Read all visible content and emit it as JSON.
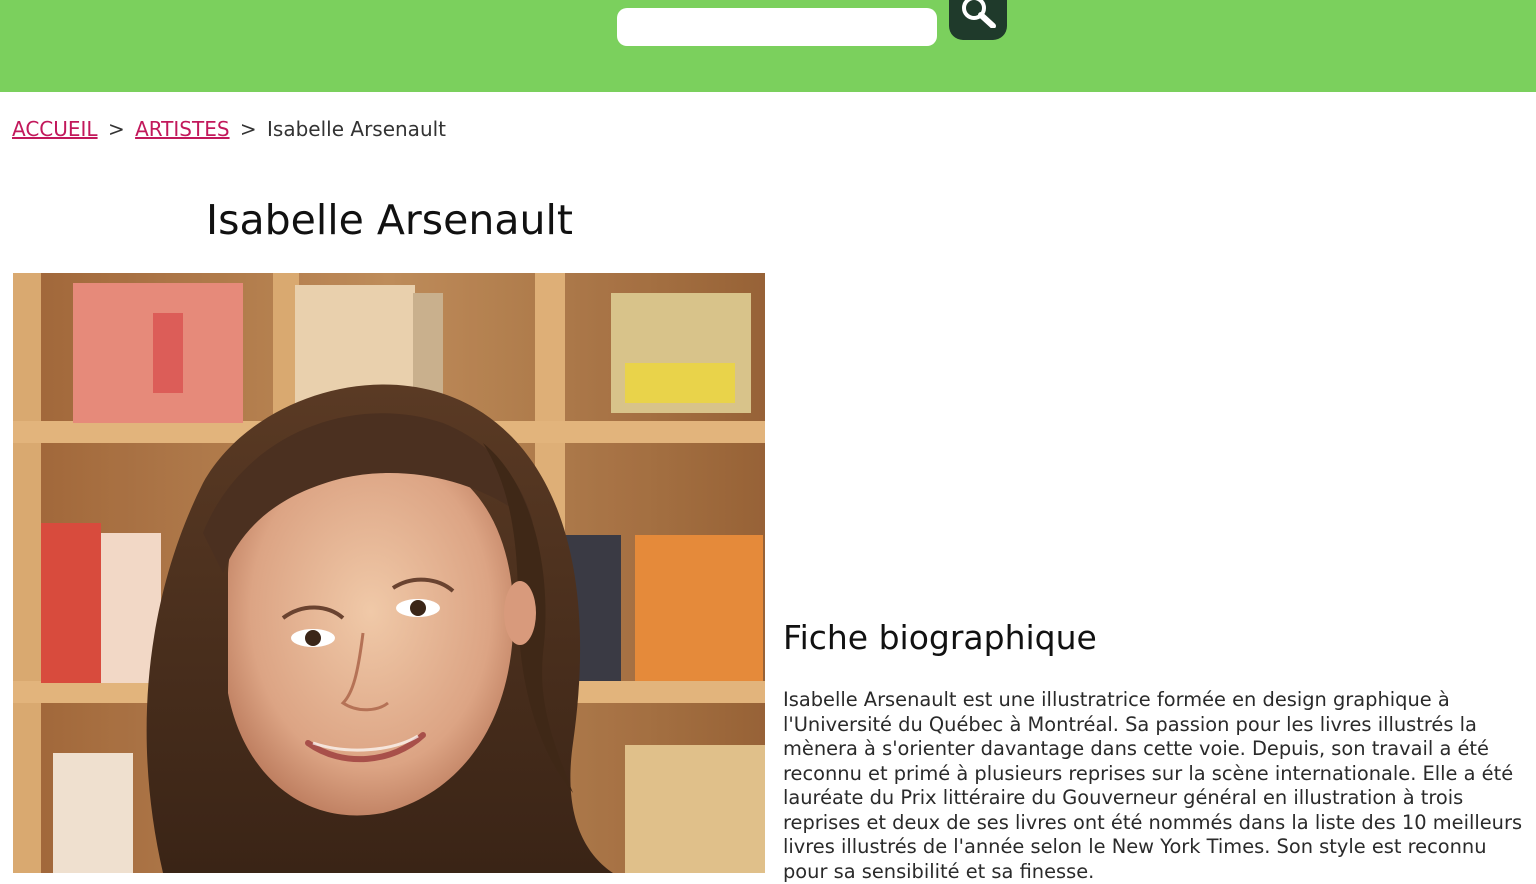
{
  "header": {
    "search_placeholder": "",
    "search_value": "",
    "search_button_icon": "search-icon"
  },
  "breadcrumb": {
    "home": "ACCUEIL",
    "separator": ">",
    "artists": "ARTISTES",
    "current": "Isabelle Arsenault"
  },
  "page": {
    "title": "Isabelle Arsenault",
    "photo_alt": "Isabelle Arsenault"
  },
  "bio": {
    "heading": "Fiche biographique",
    "text": "Isabelle Arsenault est une illustratrice formée en design graphique à l'Université du Québec à Montréal. Sa passion pour les livres illustrés la mènera à s'orienter davantage dans cette voie. Depuis, son travail a été reconnu et primé à plusieurs reprises sur la scène internationale. Elle a été lauréate du Prix littéraire du Gouverneur général en illustration à trois reprises et deux de ses livres ont été nommés dans la liste des 10 meilleurs livres illustrés de l'année selon le New York Times. Son style est reconnu pour sa sensibilité et sa finesse."
  },
  "colors": {
    "header_bg": "#7bd05d",
    "search_button_bg": "#1f3a2b",
    "link": "#c2185b"
  }
}
